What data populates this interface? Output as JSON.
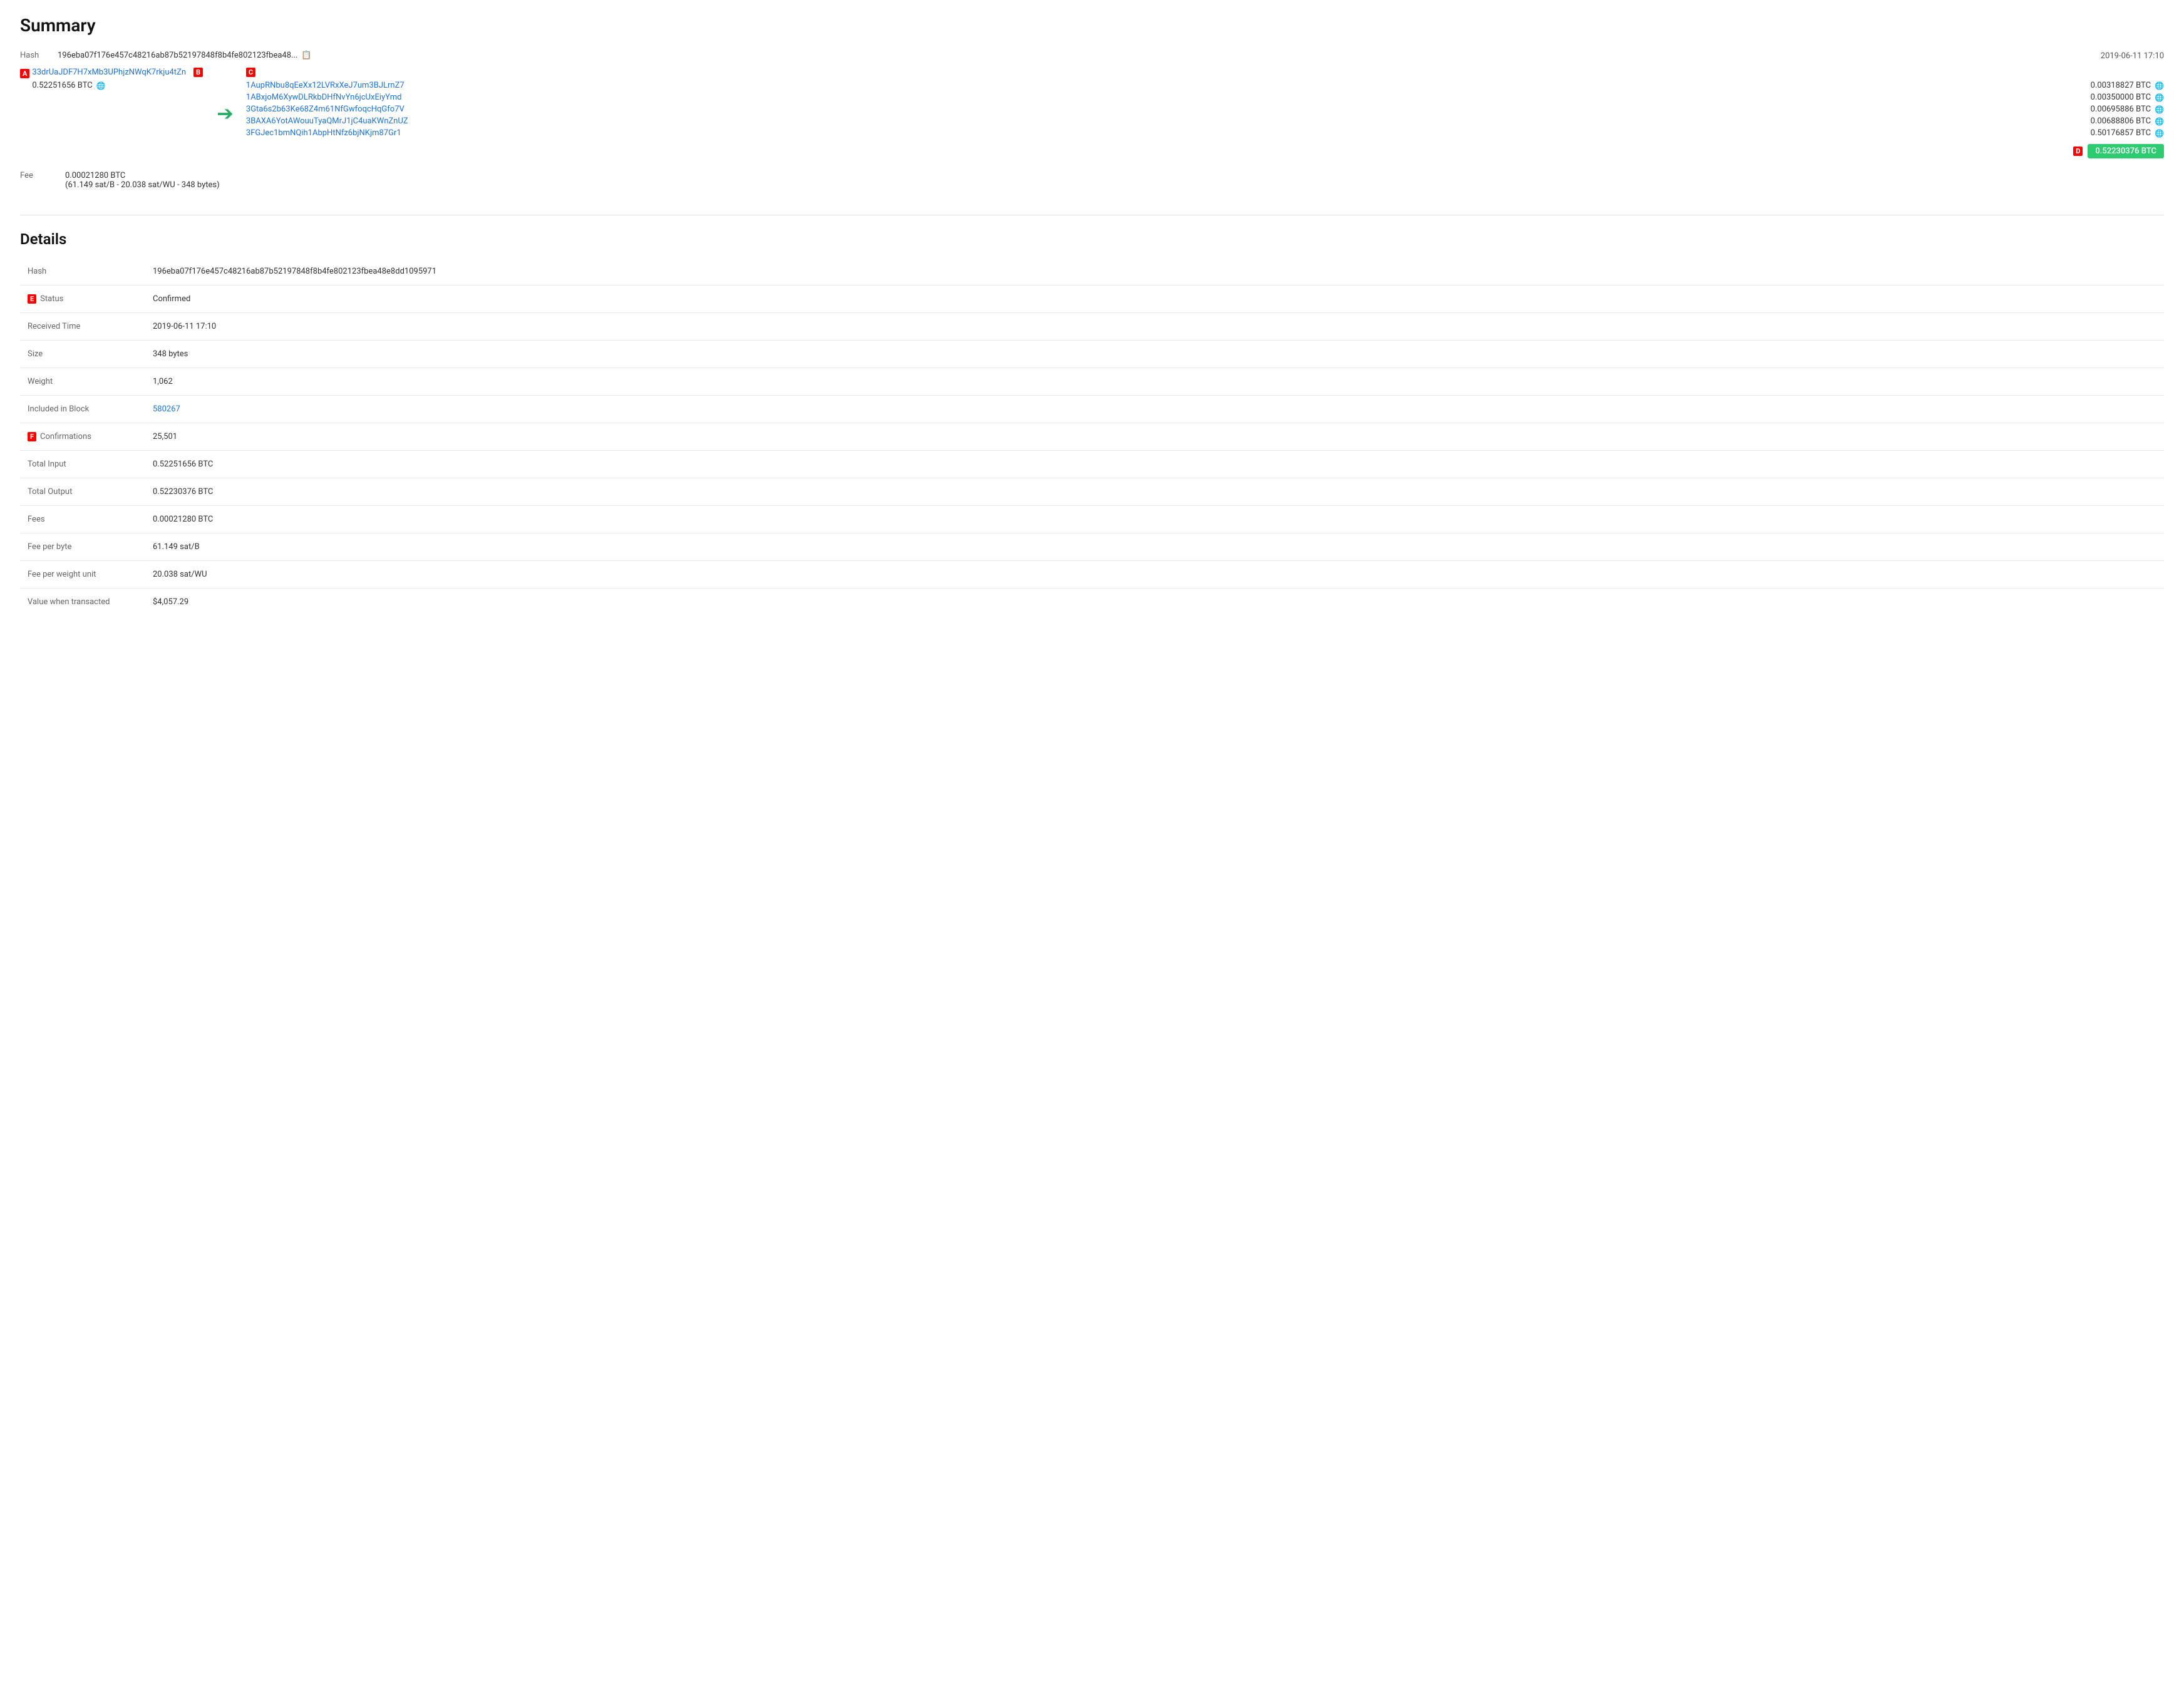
{
  "summary": {
    "title": "Summary",
    "hash_label": "Hash",
    "hash_short": "196eba07f176e457c48216ab87b52197848f8b4fe802123fbea48...",
    "hash_full": "196eba07f176e457c48216ab87b52197848f8b4fe802123fbea48e8dd1095971",
    "timestamp": "2019-06-11 17:10",
    "input_address": "33drUaJDF7H7xMb3UPhjzNWqK7rkju4tZn",
    "input_amount": "0.52251656 BTC",
    "outputs": [
      {
        "address": "1AupRNbu8qEeXx12LVRxXeJ7um3BJLrnZ7",
        "amount": "0.00318827 BTC"
      },
      {
        "address": "1ABxjoM6XywDLRkbDHfNvYn6jcUxEiyYmd",
        "amount": "0.00350000 BTC"
      },
      {
        "address": "3Gta6s2b63Ke68Z4m61NfGwfoqcHqGfo7V",
        "amount": "0.00695886 BTC"
      },
      {
        "address": "3BAXA6YotAWouuTyaQMrJ1jC4uaKWnZnUZ",
        "amount": "0.00688806 BTC"
      },
      {
        "address": "3FGJec1bmNQih1AbpHtNfz6bjNKjm87Gr1",
        "amount": "0.50176857 BTC"
      }
    ],
    "total_output": "0.52230376 BTC",
    "fee_label": "Fee",
    "fee_value": "0.00021280 BTC",
    "fee_detail": "(61.149 sat/B - 20.038 sat/WU - 348 bytes)"
  },
  "details": {
    "title": "Details",
    "rows": [
      {
        "label": "Hash",
        "value": "196eba07f176e457c48216ab87b52197848f8b4fe802123fbea48e8dd1095971",
        "type": "text"
      },
      {
        "label": "Status",
        "value": "Confirmed",
        "type": "status"
      },
      {
        "label": "Received Time",
        "value": "2019-06-11 17:10",
        "type": "text"
      },
      {
        "label": "Size",
        "value": "348 bytes",
        "type": "text"
      },
      {
        "label": "Weight",
        "value": "1,062",
        "type": "text"
      },
      {
        "label": "Included in Block",
        "value": "580267",
        "type": "link"
      },
      {
        "label": "Confirmations",
        "value": "25,501",
        "type": "text"
      },
      {
        "label": "Total Input",
        "value": "0.52251656 BTC",
        "type": "text"
      },
      {
        "label": "Total Output",
        "value": "0.52230376 BTC",
        "type": "text"
      },
      {
        "label": "Fees",
        "value": "0.00021280 BTC",
        "type": "text"
      },
      {
        "label": "Fee per byte",
        "value": "61.149 sat/B",
        "type": "text"
      },
      {
        "label": "Fee per weight unit",
        "value": "20.038 sat/WU",
        "type": "text"
      },
      {
        "label": "Value when transacted",
        "value": "$4,057.29",
        "type": "text"
      }
    ]
  },
  "markers": {
    "a": "A",
    "b": "B",
    "c": "C",
    "d": "D",
    "e": "E",
    "f": "F"
  }
}
